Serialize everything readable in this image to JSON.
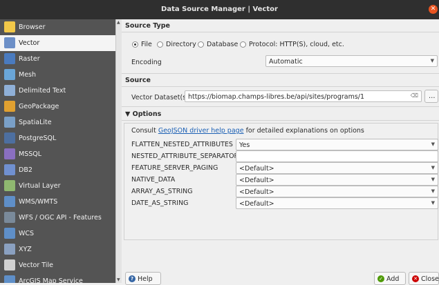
{
  "window": {
    "title": "Data Source Manager | Vector",
    "close_icon": "close-icon"
  },
  "sidebar": {
    "items": [
      {
        "label": "Browser",
        "icon": "folder-icon",
        "color": "#f2c849"
      },
      {
        "label": "Vector",
        "icon": "vector-icon",
        "color": "#6c8fc7",
        "selected": true
      },
      {
        "label": "Raster",
        "icon": "raster-icon",
        "color": "#4a7bbf"
      },
      {
        "label": "Mesh",
        "icon": "mesh-icon",
        "color": "#6aa6d8"
      },
      {
        "label": "Delimited Text",
        "icon": "delimited-text-icon",
        "color": "#8fb0d8"
      },
      {
        "label": "GeoPackage",
        "icon": "geopackage-icon",
        "color": "#e0a030"
      },
      {
        "label": "SpatiaLite",
        "icon": "spatialite-icon",
        "color": "#7aa0c8"
      },
      {
        "label": "PostgreSQL",
        "icon": "postgresql-icon",
        "color": "#4d6fa0"
      },
      {
        "label": "MSSQL",
        "icon": "mssql-icon",
        "color": "#8a6fc0"
      },
      {
        "label": "DB2",
        "icon": "db2-icon",
        "color": "#7090d0"
      },
      {
        "label": "Virtual Layer",
        "icon": "virtual-layer-icon",
        "color": "#8fb870"
      },
      {
        "label": "WMS/WMTS",
        "icon": "wms-icon",
        "color": "#5f8fc8"
      },
      {
        "label": "WFS / OGC API - Features",
        "icon": "wfs-icon",
        "color": "#7a8a9a"
      },
      {
        "label": "WCS",
        "icon": "wcs-icon",
        "color": "#5f8fc8"
      },
      {
        "label": "XYZ",
        "icon": "xyz-icon",
        "color": "#8aa0c0"
      },
      {
        "label": "Vector Tile",
        "icon": "vector-tile-icon",
        "color": "#d0d0d0"
      },
      {
        "label": "ArcGIS Map Service",
        "icon": "arcgis-icon",
        "color": "#5f8fc8"
      }
    ]
  },
  "source_type": {
    "heading": "Source Type",
    "options": [
      {
        "label": "File",
        "checked": true
      },
      {
        "label": "Directory",
        "checked": false
      },
      {
        "label": "Database",
        "checked": false
      },
      {
        "label": "Protocol: HTTP(S), cloud, etc.",
        "checked": false
      }
    ],
    "encoding_label": "Encoding",
    "encoding_value": "Automatic"
  },
  "source": {
    "heading": "Source",
    "dataset_label": "Vector Dataset(s)",
    "dataset_value": "https://biomap.champs-libres.be/api/sites/programs/1",
    "browse_label": "…"
  },
  "options": {
    "heading": "Options",
    "consult_prefix": "Consult ",
    "consult_link": "GeoJSON driver help page",
    "consult_suffix": " for detailed explanations on options",
    "rows": [
      {
        "label": "FLATTEN_NESTED_ATTRIBUTES",
        "value": "Yes",
        "kind": "combo"
      },
      {
        "label": "NESTED_ATTRIBUTE_SEPARATOR",
        "value": "",
        "kind": "text"
      },
      {
        "label": "FEATURE_SERVER_PAGING",
        "value": "<Default>",
        "kind": "combo"
      },
      {
        "label": "NATIVE_DATA",
        "value": "<Default>",
        "kind": "combo"
      },
      {
        "label": "ARRAY_AS_STRING",
        "value": "<Default>",
        "kind": "combo"
      },
      {
        "label": "DATE_AS_STRING",
        "value": "<Default>",
        "kind": "combo"
      }
    ]
  },
  "footer": {
    "help_label": "Help",
    "add_label": "Add",
    "close_label": "Close"
  },
  "colors": {
    "help": "#3465a4",
    "add": "#4e9a06",
    "close": "#cc0000",
    "accent_close": "#e95420"
  }
}
